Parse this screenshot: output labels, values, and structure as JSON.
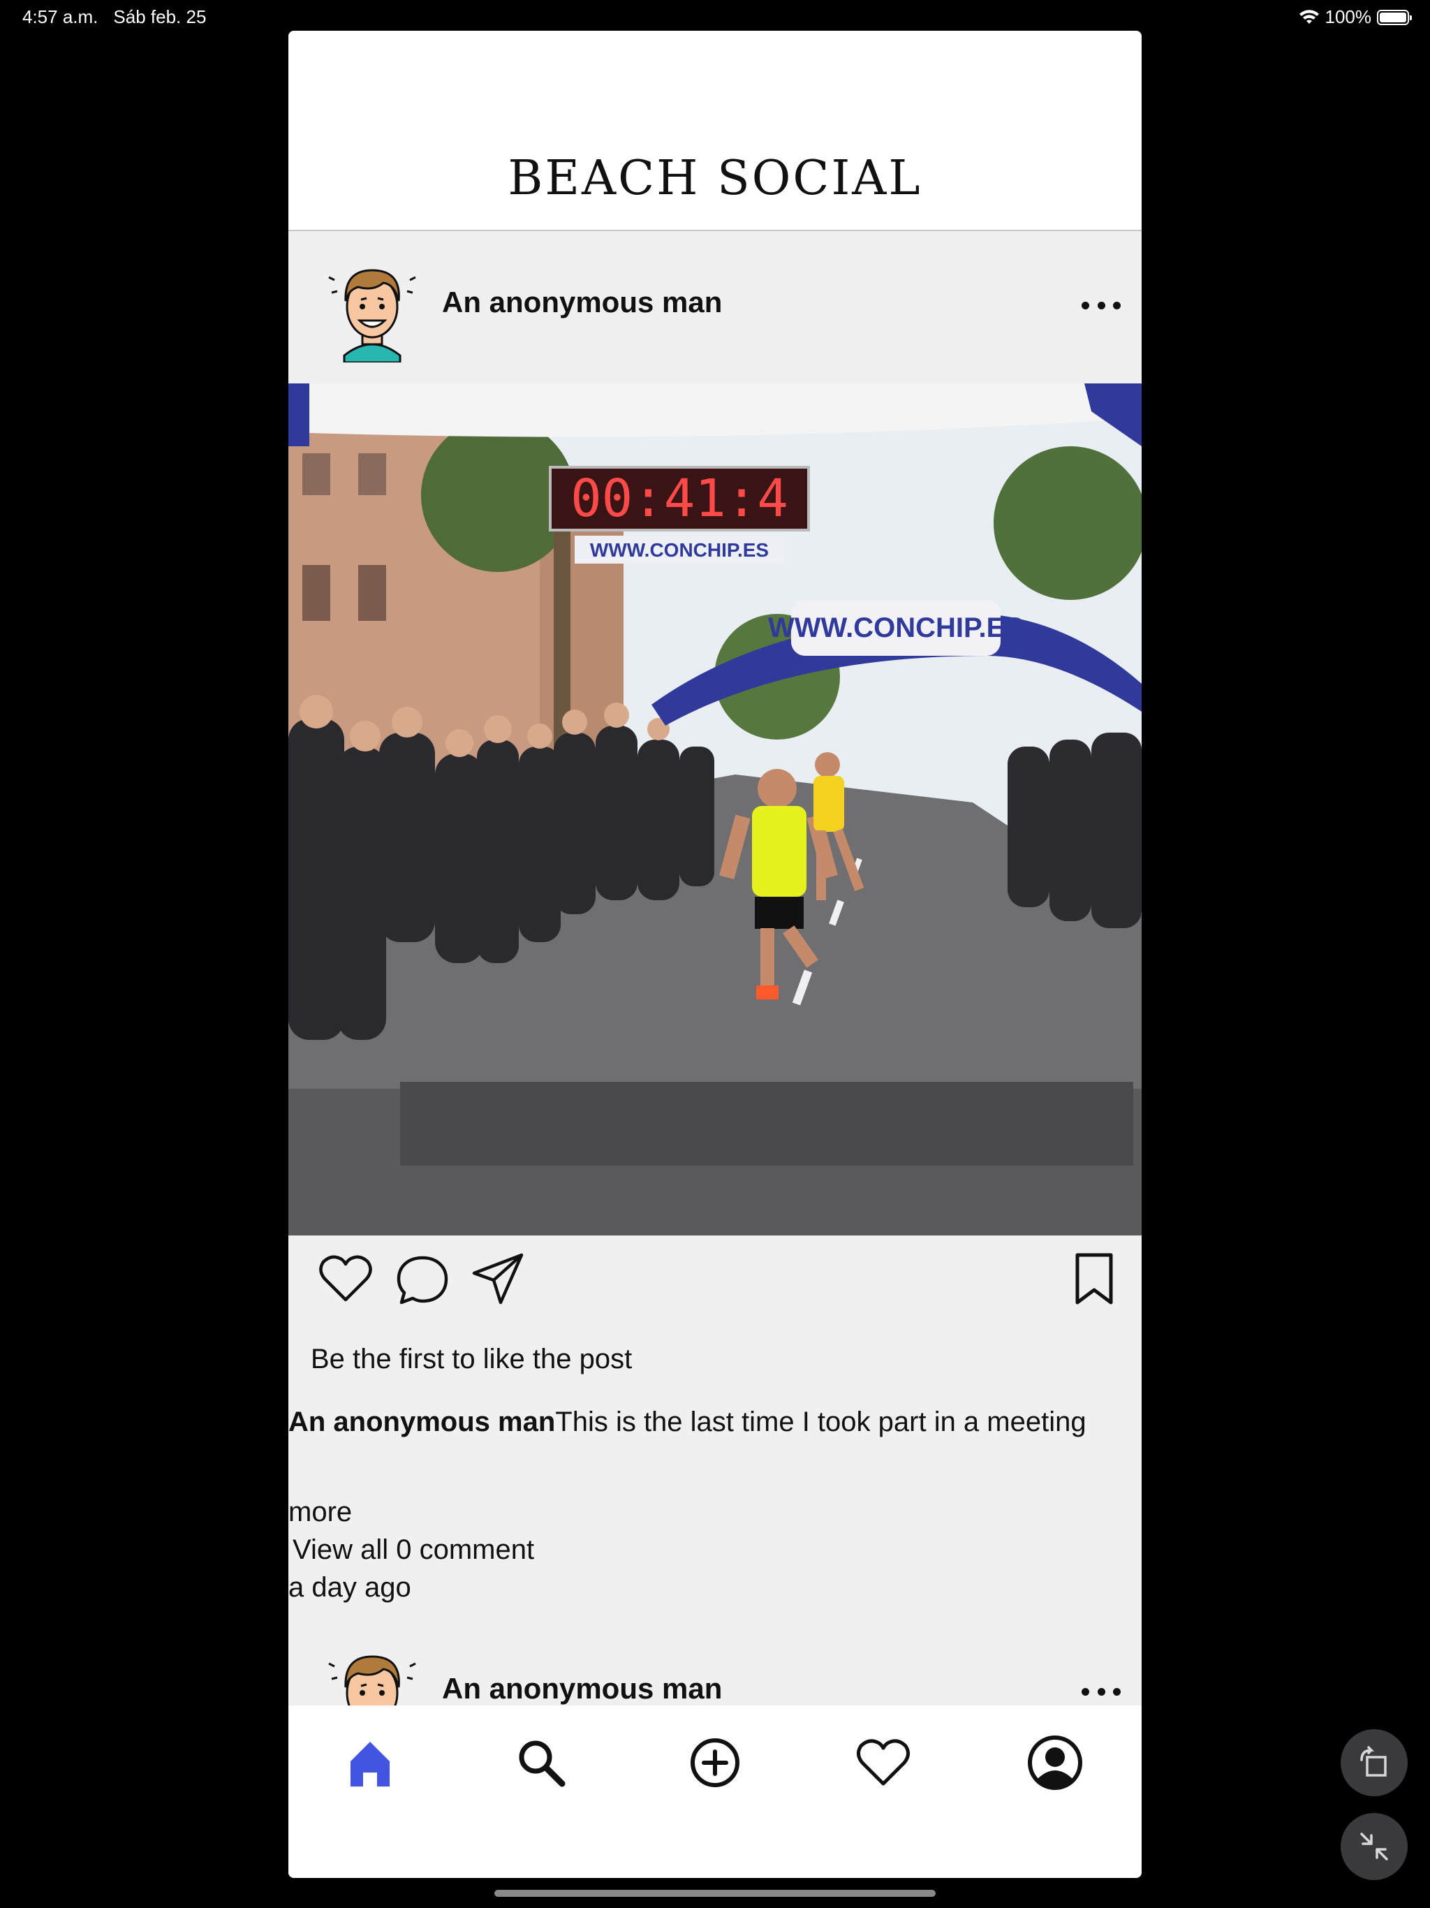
{
  "status_bar": {
    "time": "4:57 a.m.",
    "date": "Sáb feb. 25",
    "battery": "100%",
    "battery_level": 1.0
  },
  "app": {
    "title": "BEACH SOCIAL"
  },
  "posts": [
    {
      "username": "An anonymous man",
      "image_text": {
        "timer": "00:41:4",
        "banner_small": "WWW.CONCHIP.ES",
        "banner_arch": "WWW.CONCHIP.ES"
      },
      "likes_text": "Be the first to like the post",
      "caption_user": "An anonymous man",
      "caption_text": "This is the last time I took part in a meeting",
      "more_label": "more",
      "comments_label": "View all 0 comment",
      "time_ago": "a day ago",
      "liked": false,
      "saved": false
    },
    {
      "username": "An anonymous man"
    }
  ],
  "tab_bar": {
    "items": [
      {
        "name": "home",
        "icon": "home-icon",
        "active": true
      },
      {
        "name": "search",
        "icon": "search-icon",
        "active": false
      },
      {
        "name": "add",
        "icon": "add-circle-icon",
        "active": false
      },
      {
        "name": "activity",
        "icon": "heart-icon",
        "active": false
      },
      {
        "name": "profile",
        "icon": "profile-icon",
        "active": false
      }
    ],
    "active_color": "#4355e0"
  },
  "system_buttons": [
    "rotate-icon",
    "minimize-icon"
  ]
}
